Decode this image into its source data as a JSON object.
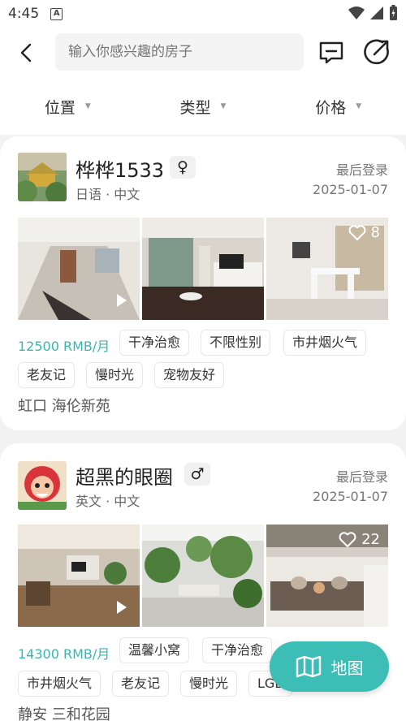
{
  "status_bar": {
    "time": "4:45"
  },
  "search": {
    "placeholder": "输入你感兴趣的房子"
  },
  "filters": [
    {
      "label": "位置"
    },
    {
      "label": "类型"
    },
    {
      "label": "价格"
    }
  ],
  "listings": [
    {
      "name": "桦桦1533",
      "gender_symbol": "♀",
      "languages": "日语 · 中文",
      "login_label": "最后登录",
      "login_date": "2025-01-07",
      "price": "12500 RMB/月",
      "favorite_count": "8",
      "tags": [
        "干净治愈",
        "不限性别",
        "市井烟火气",
        "老友记",
        "慢时光",
        "宠物友好"
      ],
      "address": "虹口 海伦新苑"
    },
    {
      "name": "超黑的眼圈",
      "gender_symbol": "♂",
      "languages": "英文 · 中文",
      "login_label": "最后登录",
      "login_date": "2025-01-07",
      "price": "14300 RMB/月",
      "favorite_count": "22",
      "tags": [
        "温馨小窝",
        "干净治愈",
        "市井烟火气",
        "老友记",
        "慢时光",
        "LGB"
      ],
      "address": "静安 三和花园"
    }
  ],
  "map_button": {
    "label": "地图"
  },
  "colors": {
    "accent": "#3ab6b0",
    "map_button": "#3cbdb5"
  }
}
